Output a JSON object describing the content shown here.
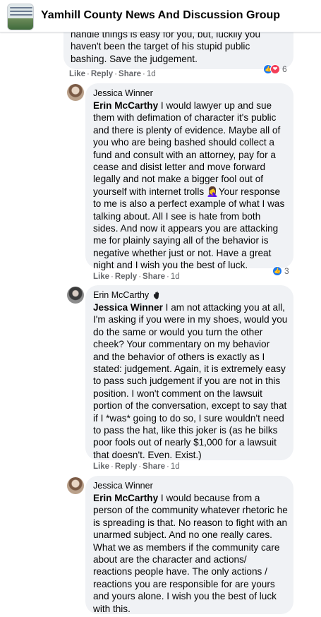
{
  "header": {
    "group_name": "Yamhill County News And Discussion Group"
  },
  "comments": [
    {
      "author": "",
      "text_lines": [
        "handle things is easy for you, but, luckily you",
        "haven't been the target of his stupid public",
        "bashing. Save the judgement."
      ],
      "actions": {
        "like": "Like",
        "reply": "Reply",
        "share": "Share",
        "time": "1d"
      },
      "reactions": {
        "types": [
          "like",
          "love"
        ],
        "count": "6"
      }
    },
    {
      "author": "Jessica Winner",
      "mention": "Erin McCarthy",
      "text": " I would lawyer up and sue them with defimation of character it's public and there is plenty of evidence. Maybe all of you who are being bashed should collect a fund and consult with an attorney, pay for a cease and disist letter and move forward legally and not make a bigger fool out of yourself with internet trolls 🤦‍♀️Your response to me is also a perfect example of what I was talking about. All I see is hate from both sides. And now it appears you are attacking me for plainly saying all of the behavior is negative whether just or not. Have a great night and I wish you the best of luck.",
      "actions": {
        "like": "Like",
        "reply": "Reply",
        "share": "Share",
        "time": "1d"
      },
      "reactions": {
        "types": [
          "like"
        ],
        "count": "3"
      }
    },
    {
      "author": "Erin McCarthy",
      "author_badge": "rising-fan-icon",
      "mention": "Jessica Winner",
      "text": " I am not attacking you at all, I'm asking if you were in my shoes, would you do the same or would you turn the other cheek? Your commentary on my behavior and the behavior of others is exactly as I stated: judgement. Again, it is extremely easy to pass such judgement if you are not in this position. I won't comment on the lawsuit portion of the conversation, except to say that if I *was* going to do so, I sure wouldn't need to pass the hat, like this joker is (as he bilks poor fools out of nearly $1,000 for a lawsuit that doesn't. Even. Exist.)",
      "actions": {
        "like": "Like",
        "reply": "Reply",
        "share": "Share",
        "time": "1d"
      }
    },
    {
      "author": "Jessica Winner",
      "mention": "Erin McCarthy",
      "text": " I would because from a person of the community whatever rhetoric he is spreading is that. No reason to fight with an unarmed subject. And no one really cares. What we as members if the community care about are the character and actions/ reactions people have. The only actions / reactions you are responsible for are yours and yours alone. I wish you the best of luck with this."
    }
  ],
  "colors": {
    "bubble_bg": "#f0f2f5",
    "text": "#050505",
    "secondary_text": "#65676b",
    "like_blue": "#1877f2",
    "love_red": "#f33e58"
  }
}
